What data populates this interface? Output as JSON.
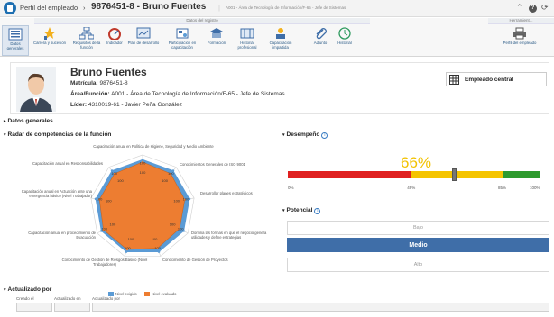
{
  "top": {
    "title": "Perfil del empleado",
    "employee_code": "9876451-8 - Bruno Fuentes",
    "breadcrumb_sub": "A001 - Área de Tecnología de Información/F-65 - Jefe de Sistemas"
  },
  "toolbar": {
    "group_registry": "Datos del registro",
    "group_tool": "Herramient...",
    "buttons": [
      {
        "label": "Datos generales",
        "icon": "datos-generales-icon"
      },
      {
        "label": "Carrera y sucesión",
        "icon": "carrera-icon"
      },
      {
        "label": "Requisitos de la función",
        "icon": "requisitos-icon"
      },
      {
        "label": "Indicador",
        "icon": "indicador-icon"
      },
      {
        "label": "Plan de desarrollo",
        "icon": "plan-icon"
      },
      {
        "label": "Participación en capacitación",
        "icon": "participacion-icon"
      },
      {
        "label": "Formación",
        "icon": "formacion-icon"
      },
      {
        "label": "Historial profesional",
        "icon": "historial-prof-icon"
      },
      {
        "label": "Capacitación impartida",
        "icon": "capacitacion-icon"
      },
      {
        "label": "Adjunto",
        "icon": "adjunto-icon"
      },
      {
        "label": "Historial",
        "icon": "historial-icon"
      },
      {
        "label": "Perfil del empleado",
        "icon": "print-icon"
      }
    ]
  },
  "employee": {
    "name": "Bruno Fuentes",
    "matricula_label": "Matrícula:",
    "matricula": "9876451-8",
    "area_label": "Área/Función:",
    "area": "A001 - Área de Tecnología de Información/F-65 - Jefe de Sistemas",
    "lider_label": "Líder:",
    "lider": "4310019-61 - Javier Peña González",
    "central_label": "Empleado central"
  },
  "sections": {
    "datos_generales": "Datos generales",
    "radar": "Radar de competencias de la función",
    "desempeno": "Desempeño",
    "potencial": "Potencial",
    "actualizado": "Actualizado por"
  },
  "radar": {
    "axes": [
      "Capacitación anual en Política de Higiene, Seguridad y Medio Ambiente",
      "Conocimientos Generales de ISO 9001",
      "Desarrollar planes estratégicos",
      "Domina las formas en que el negocio genera utilidades y define estrategias",
      "Conocimiento de Gestión de Proyectos",
      "Conocimiento de Gestión de Riesgos Básico (Nivel Trabajadores)",
      "Capacitación anual en procedimiento de Evacuación",
      "Capacitación anual en Actuación ante una emergencia básico (Nivel Trabajador)",
      "Capacitación anual en Responsabilidades"
    ],
    "values_required": [
      100,
      100,
      100,
      100,
      100,
      100,
      100,
      100,
      100
    ],
    "values_evaluated": [
      95,
      92,
      90,
      90,
      92,
      95,
      95,
      92,
      92
    ],
    "labels_required": [
      "100",
      "100",
      "100",
      "100",
      "100",
      "100",
      "100",
      "100",
      "100"
    ],
    "labels_evaluated": [
      "100",
      "100",
      "100",
      "100",
      "100",
      "100",
      "100",
      "100",
      "100"
    ],
    "legend_required": "Nivel exigido",
    "legend_evaluated": "Nivel evaluado",
    "color_required": "#5b9bd5",
    "color_evaluated": "#ed7d31"
  },
  "desempeno": {
    "value_text": "66%",
    "value": 66,
    "ticks": [
      "0%",
      "49%",
      "85%",
      "100%"
    ],
    "color_low": "#e02020",
    "color_mid": "#f5c400",
    "color_high": "#2e9a2e",
    "color_value": "#f5c400"
  },
  "potencial": {
    "options": [
      "Bajo",
      "Medio",
      "Alto"
    ],
    "selected": "Medio"
  },
  "actualizado": {
    "columns": [
      "Creado el",
      "Actualizado en",
      "Actualizado por"
    ]
  }
}
